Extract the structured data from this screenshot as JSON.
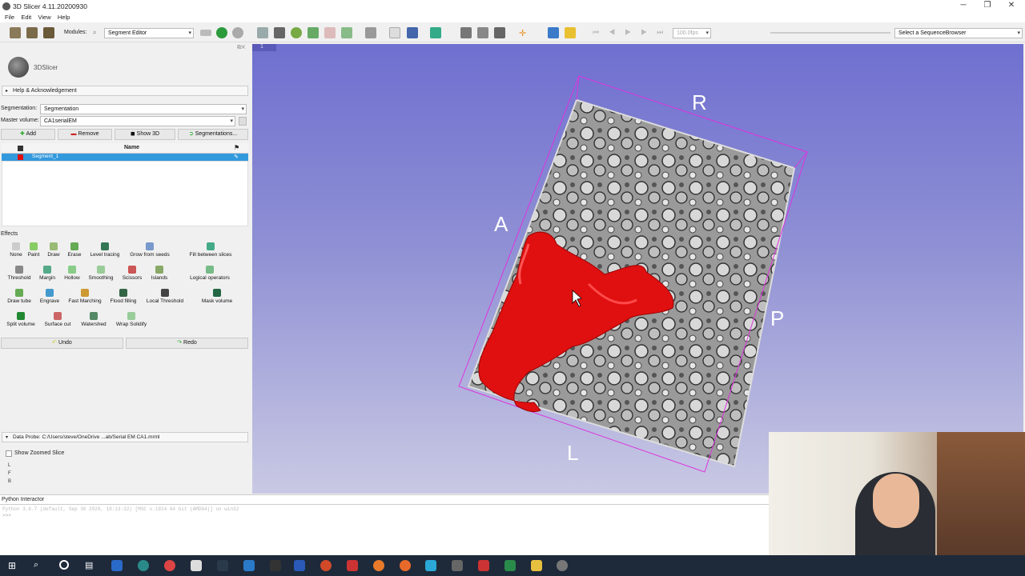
{
  "window": {
    "title": "3D Slicer 4.11.20200930"
  },
  "menu": [
    "File",
    "Edit",
    "View",
    "Help"
  ],
  "toolbar": {
    "modules_label": "Modules:",
    "module_selected": "Segment Editor",
    "fps": "100.0fps",
    "sequence_browser": "Select a SequenceBrowser"
  },
  "left": {
    "logo_text": "3DSlicer",
    "help_ack": "Help & Acknowledgement",
    "segmentation_label": "Segmentation:",
    "segmentation_value": "Segmentation",
    "master_label": "Master volume:",
    "master_value": "CA1serialEM",
    "add": "Add",
    "remove": "Remove",
    "show3d": "Show 3D",
    "segmentations": "Segmentations...",
    "table_header": "Name",
    "segment_name": "Segment_1",
    "effects_label": "Effects",
    "effects": [
      [
        "None",
        "Paint",
        "Draw",
        "Erase",
        "Level tracing",
        "Grow from seeds",
        "Fill between slices"
      ],
      [
        "Threshold",
        "Margin",
        "Hollow",
        "Smoothing",
        "Scissors",
        "Islands",
        "Logical operators"
      ],
      [
        "Draw tube",
        "Engrave",
        "Fast Marching",
        "Flood filling",
        "Local Threshold",
        "Mask volume"
      ],
      [
        "Split volume",
        "Surface cut",
        "Watershed",
        "Wrap Solidify"
      ]
    ],
    "undo": "Undo",
    "redo": "Redo",
    "data_probe": "Data Probe: C:/Users/steve/OneDrive ...ab/Serial EM CA1.mrml",
    "show_zoomed": "Show Zoomed Slice",
    "probe_letters": [
      "L",
      "F",
      "B"
    ]
  },
  "view": {
    "label_num": "1",
    "orient": {
      "R": "R",
      "A": "A",
      "P": "P",
      "L": "L"
    }
  },
  "python": {
    "title": "Python Interactor",
    "line1": "Python 3.6.7 (default, Sep 30 2020, 18:13:32) [MSC v.1924 64 bit (AMD64)] on win32",
    "prompt": ">>>"
  },
  "colors": {
    "segment": "#e01010",
    "selection": "#3399dd"
  }
}
